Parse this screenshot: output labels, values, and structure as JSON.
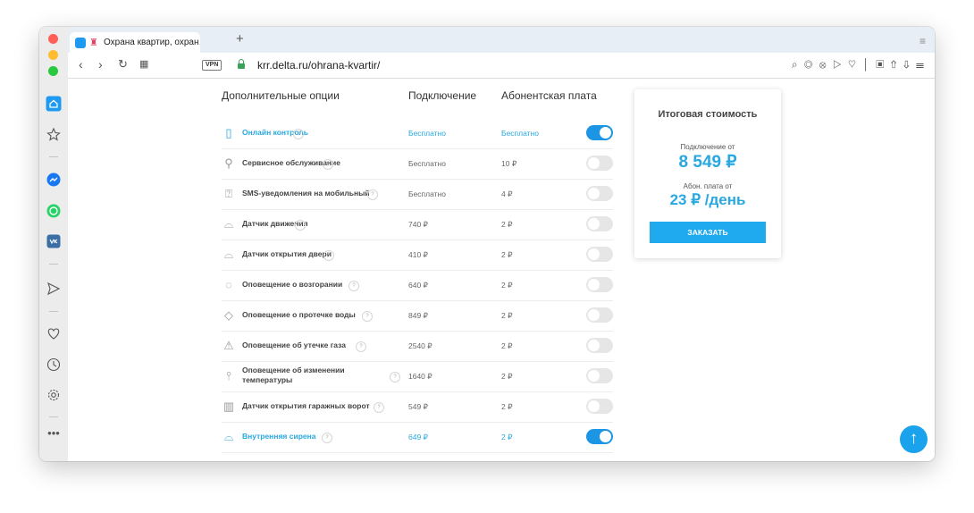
{
  "browser": {
    "tab_title": "Охрана квартир, охран…",
    "new_tab": "+",
    "vpn_label": "VPN",
    "url": "krr.delta.ru/ohrana-kvartir/"
  },
  "table": {
    "header_options": "Дополнительные опции",
    "header_connection": "Подключение",
    "header_fee": "Абонентская плата",
    "rows": [
      {
        "icon": "smartphone-icon",
        "name": "Онлайн контроль",
        "connection": "Бесплатно",
        "fee": "Бесплатно",
        "enabled": true
      },
      {
        "icon": "wrench-icon",
        "name": "Сервисное обслуживание",
        "connection": "Бесплатно",
        "fee": "10 ₽",
        "enabled": false
      },
      {
        "icon": "sms-icon",
        "name": "SMS-уведомления на мобильный",
        "connection": "Бесплатно",
        "fee": "4 ₽",
        "enabled": false
      },
      {
        "icon": "motion-sensor-icon",
        "name": "Датчик движения",
        "connection": "740 ₽",
        "fee": "2 ₽",
        "enabled": false
      },
      {
        "icon": "door-sensor-icon",
        "name": "Датчик открытия двери",
        "connection": "410 ₽",
        "fee": "2 ₽",
        "enabled": false
      },
      {
        "icon": "fire-icon",
        "name": "Оповещение о возгорании",
        "connection": "640 ₽",
        "fee": "2 ₽",
        "enabled": false
      },
      {
        "icon": "water-drop-icon",
        "name": "Оповещение о протечке воды",
        "connection": "849 ₽",
        "fee": "2 ₽",
        "enabled": false
      },
      {
        "icon": "gas-icon",
        "name": "Оповещение об утечке газа",
        "connection": "2540 ₽",
        "fee": "2 ₽",
        "enabled": false
      },
      {
        "icon": "thermometer-icon",
        "name": "Оповещение об изменении температуры",
        "connection": "1640 ₽",
        "fee": "2 ₽",
        "enabled": false
      },
      {
        "icon": "garage-icon",
        "name": "Датчик открытия гаражных ворот",
        "connection": "549 ₽",
        "fee": "2 ₽",
        "enabled": false
      },
      {
        "icon": "siren-icon",
        "name": "Внутренняя сирена",
        "connection": "649 ₽",
        "fee": "2 ₽",
        "enabled": true
      }
    ]
  },
  "summary": {
    "title": "Итоговая стоимость",
    "connection_label": "Подключение от",
    "connection_value": "8 549 ₽",
    "fee_label": "Абон. плата от",
    "fee_value": "23 ₽ /день",
    "order_button": "ЗАКАЗАТЬ"
  },
  "colors": {
    "accent": "#27a8e0",
    "button": "#1fa9ef",
    "toggle_on": "#1c95e4"
  }
}
